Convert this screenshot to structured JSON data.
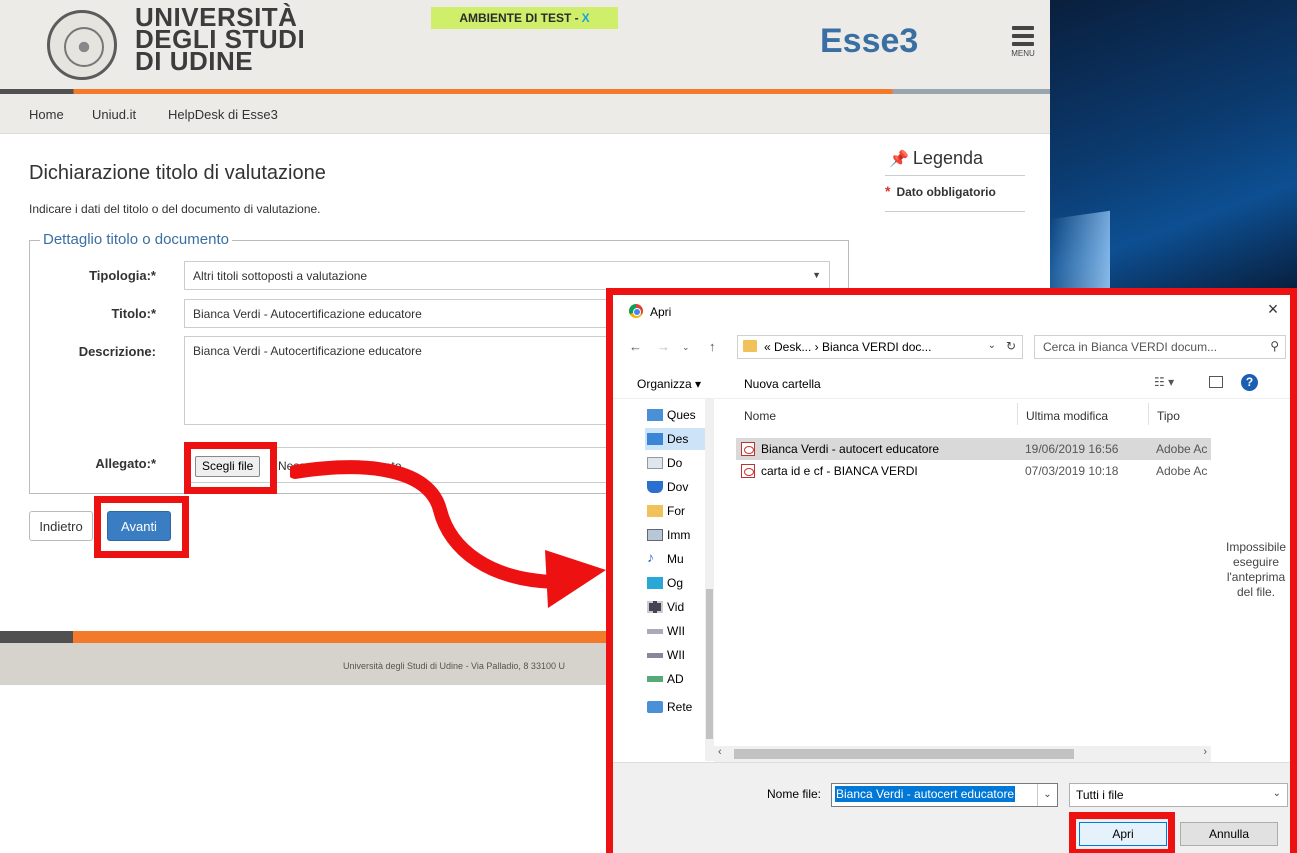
{
  "header": {
    "logo_text": [
      "UNIVERSITÀ",
      "DEGLI STUDI",
      "DI UDINE"
    ],
    "test_banner": "AMBIENTE DI TEST -",
    "test_banner_close": "X",
    "brand": "Esse3",
    "menu_label": "MENU"
  },
  "nav": {
    "items": [
      "Home",
      "Uniud.it",
      "HelpDesk di Esse3"
    ]
  },
  "main": {
    "title": "Dichiarazione titolo di valutazione",
    "subtitle": "Indicare i dati del titolo o del documento di valutazione.",
    "fieldset_legend": "Dettaglio titolo o documento",
    "fields": {
      "tipologia_label": "Tipologia:*",
      "tipologia_value": "Altri titoli sottoposti a valutazione",
      "titolo_label": "Titolo:*",
      "titolo_value": "Bianca Verdi - Autocertificazione educatore",
      "descrizione_label": "Descrizione:",
      "descrizione_value": "Bianca Verdi - Autocertificazione educatore",
      "allegato_label": "Allegato:*",
      "choose_file": "Scegli file",
      "no_file": "Nessun file selezionato"
    },
    "back_button": "Indietro",
    "next_button": "Avanti"
  },
  "legend": {
    "title": "Legenda",
    "required_star": "*",
    "required_label": "Dato obbligatorio"
  },
  "footer": {
    "text": "Università degli Studi di Udine - Via Palladio, 8 33100 U"
  },
  "dialog": {
    "title": "Apri",
    "close": "×",
    "address": "« Desk... › Bianca VERDI doc...",
    "search_placeholder": "Cerca in Bianca VERDI docum...",
    "organize": "Organizza ▾",
    "new_folder": "Nuova cartella",
    "columns": {
      "name": "Nome",
      "modified": "Ultima modifica",
      "type": "Tipo"
    },
    "sidebar": [
      "Ques",
      "Des",
      "Do",
      "Dov",
      "For",
      "Imm",
      "Mu",
      "Og",
      "Vid",
      "WII",
      "WII",
      "AD",
      "Rete"
    ],
    "files": [
      {
        "name": "Bianca Verdi - autocert educatore",
        "modified": "19/06/2019 16:56",
        "type": "Adobe Ac"
      },
      {
        "name": "carta id e cf - BIANCA VERDI",
        "modified": "07/03/2019 10:18",
        "type": "Adobe Ac"
      }
    ],
    "preview_text": "Impossibile eseguire l'anteprima del file.",
    "filename_label": "Nome file:",
    "filename_value": "Bianca Verdi - autocert educatore",
    "filter": "Tutti i file",
    "open_button": "Apri",
    "cancel_button": "Annulla"
  },
  "colors": {
    "highlight": "#ee1111",
    "accent": "#f37a2a",
    "brand": "#3a6fa3"
  }
}
